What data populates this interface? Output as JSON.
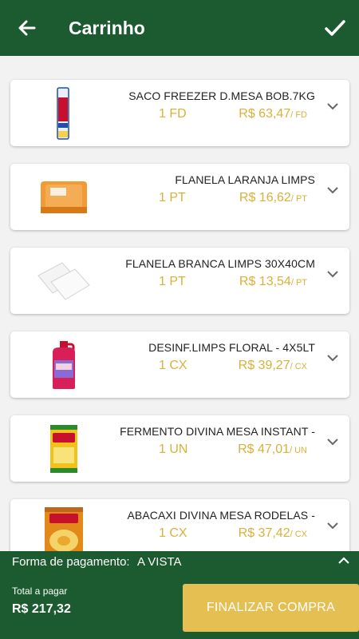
{
  "header": {
    "title": "Carrinho",
    "back_icon": "arrow-left-icon",
    "confirm_icon": "check-icon"
  },
  "items": [
    {
      "name": "SACO FREEZER D.MESA BOB.7KG",
      "qty": "1 FD",
      "price": "R$ 63,47",
      "unit": "/ FD"
    },
    {
      "name": "FLANELA LARANJA LIMPS",
      "qty": "1 PT",
      "price": "R$ 16,62",
      "unit": "/ PT"
    },
    {
      "name": "FLANELA BRANCA LIMPS 30X40CM",
      "qty": "1 PT",
      "price": "R$ 13,54",
      "unit": "/ PT"
    },
    {
      "name": "DESINF.LIMPS FLORAL - 4X5LT",
      "qty": "1 CX",
      "price": "R$ 39,27",
      "unit": "/ CX"
    },
    {
      "name": "FERMENTO DIVINA MESA INSTANT -",
      "qty": "1 UN",
      "price": "R$ 47,01",
      "unit": "/ UN"
    },
    {
      "name": "ABACAXI DIVINA MESA RODELAS -",
      "qty": "1 CX",
      "price": "R$ 37,42",
      "unit": "/ CX"
    }
  ],
  "footer": {
    "payment_label": "Forma de pagamento:",
    "payment_value": "A VISTA",
    "total_label": "Total a pagar",
    "total_value": "R$ 217,32",
    "finalize_label": "FINALIZAR COMPRA"
  },
  "colors": {
    "brand_green": "#1c5a30",
    "accent_gold": "#d9b13a",
    "button_gold": "#e5bf51"
  }
}
